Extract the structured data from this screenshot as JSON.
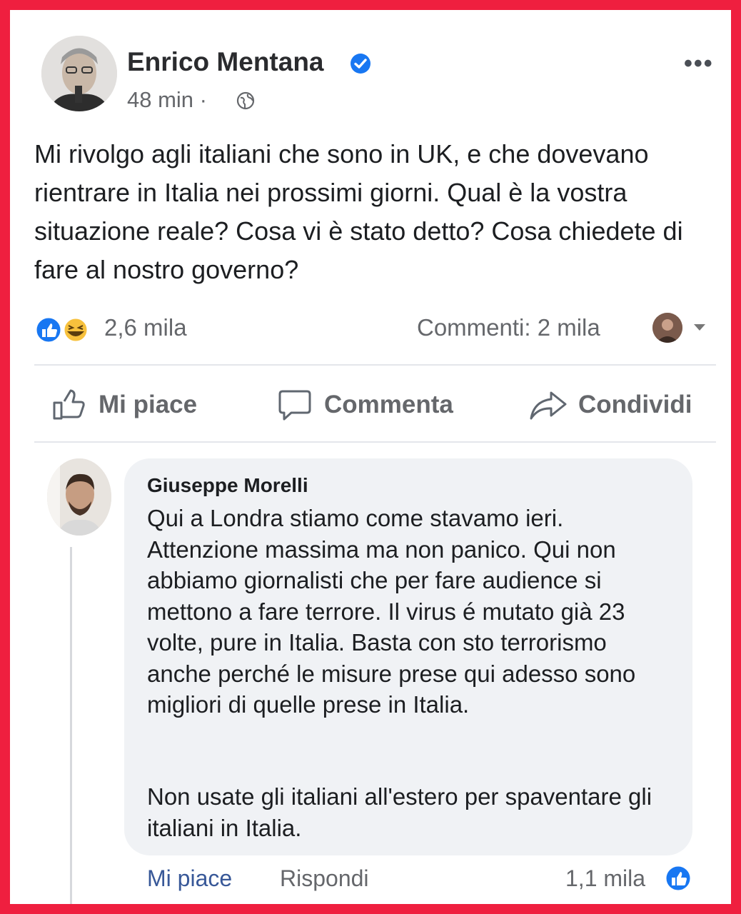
{
  "post": {
    "author": "Enrico Mentana",
    "time": "48 min ·",
    "text": "Mi rivolgo agli italiani che sono in UK, e che dovevano rientrare in Italia nei prossimi giorni. Qual è la vostra situazione reale? Cosa vi è stato detto? Cosa chiedete di fare al nostro governo?",
    "reactions_count": "2,6 mila",
    "comments_count": "Commenti: 2 mila",
    "more_label": "•••"
  },
  "actions": {
    "like": "Mi piace",
    "comment": "Comment­a",
    "share": "Condividi"
  },
  "comment": {
    "author": "Giuseppe Morelli",
    "text_p1": "Qui a Londra stiamo come stavamo ieri. Attenzione massima ma non panico. Qui non abbiamo giornalisti che per fare audience si mettono a fare terrore. Il virus é mutato già 23 volte, pure in Italia. Basta con sto terrorismo anche perché le misure prese qui adesso sono migliori di quelle prese in Italia.",
    "text_p2": "Non usate gli italiani all'estero per spaventare gli italiani in Italia.",
    "like_label": "Mi piace",
    "reply_label": "Rispondi",
    "likes_count": "1,1 mila"
  },
  "colors": {
    "frame": "#ef1f3f",
    "facebook_blue": "#1877f2",
    "link_blue": "#385898",
    "bubble": "#f0f2f5"
  },
  "icons": [
    "verified-badge-icon",
    "globe-icon",
    "more-options-icon",
    "like-reaction-icon",
    "haha-reaction-icon",
    "thumbs-up-icon",
    "comment-bubble-icon",
    "share-arrow-icon"
  ]
}
